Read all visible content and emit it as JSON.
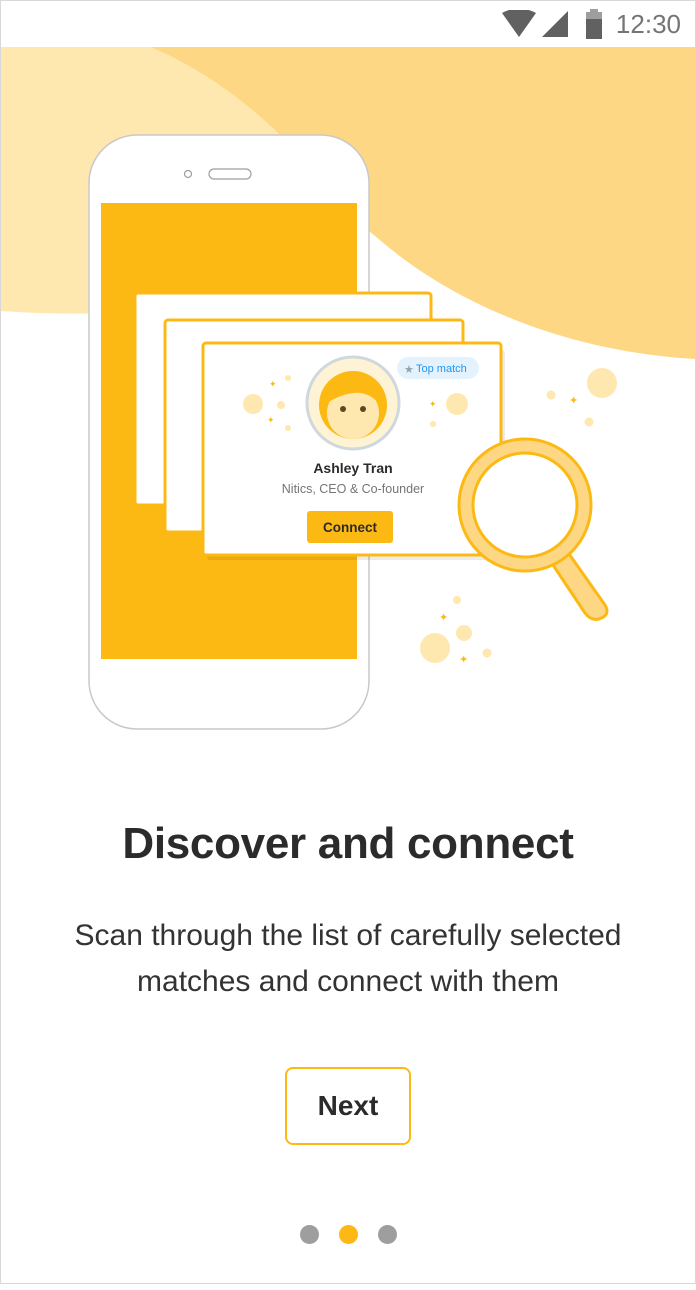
{
  "status_bar": {
    "time": "12:30",
    "icons": [
      "wifi-icon",
      "cellular-signal-icon",
      "battery-icon"
    ]
  },
  "illustration": {
    "card": {
      "name": "Ashley Tran",
      "subtitle": "Nitics, CEO & Co-founder",
      "badge": "Top match",
      "badge_icon": "star-icon",
      "button_label": "Connect"
    }
  },
  "onboarding": {
    "title": "Discover and connect",
    "description": "Scan through the list of carefully selected matches and connect with them",
    "next_label": "Next",
    "page_indicator": {
      "total": 3,
      "current": 2
    }
  },
  "colors": {
    "accent": "#FDB913",
    "accent_light": "#FDD783",
    "accent_pale": "#FFE8B0",
    "text_dark": "#2b2b2b",
    "dot_inactive": "#9e9e9e",
    "badge_bg": "#E3F2FD",
    "badge_text": "#2196F3"
  }
}
